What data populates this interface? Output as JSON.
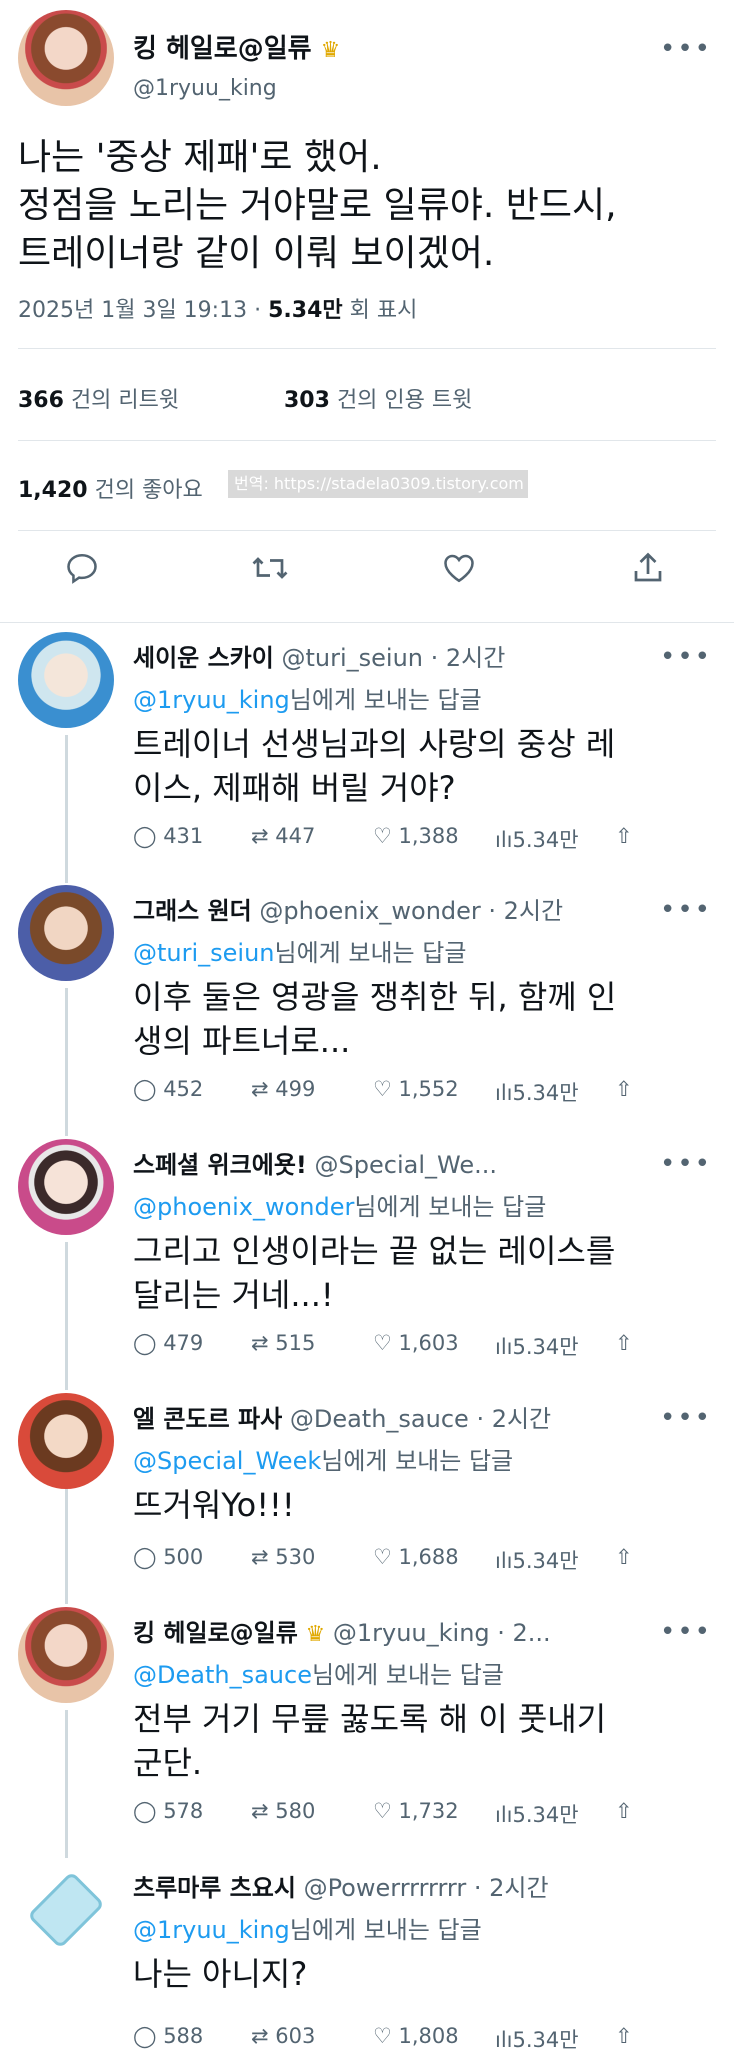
{
  "main": {
    "name": "킹 헤일로@일류",
    "handle": "@1ryuu_king",
    "text_lines": [
      "나는 '중상 제패'로 했어.",
      "정점을 노리는 거야말로 일류야. 반드시,",
      "트레이너랑 같이 이뤄 보이겠어."
    ],
    "timestamp": "2025년 1월 3일 19:13",
    "views": "5.34만",
    "views_label": "회 표시",
    "retweets": "366",
    "retweets_label": "건의 리트윗",
    "quotes": "303",
    "quotes_label": "건의 인용 트윗",
    "likes": "1,420",
    "likes_label": "건의 좋아요",
    "watermark": "번역: https://stadela0309.tistory.com"
  },
  "replies": [
    {
      "name": "세이운 스카이",
      "handle": "@turi_seiun",
      "time": "· 2시간",
      "to_handle": "@1ryuu_king",
      "to_suffix": "님에게 보내는 답글",
      "text_lines": [
        "트레이너 선생님과의 사랑의 중상 레",
        "이스, 제패해 버릴 거야?"
      ],
      "replies": "431",
      "retweets": "447",
      "likes": "1,388",
      "views": "5.34만"
    },
    {
      "name": "그래스 원더",
      "handle": "@phoenix_wonder",
      "time": "· 2시간",
      "to_handle": "@turi_seiun",
      "to_suffix": "님에게 보내는 답글",
      "text_lines": [
        "이후 둘은 영광을 쟁취한 뒤, 함께 인",
        "생의 파트너로..."
      ],
      "replies": "452",
      "retweets": "499",
      "likes": "1,552",
      "views": "5.34만"
    },
    {
      "name": "스페셜 위크에욧!",
      "handle": "@Special_We...",
      "time": "",
      "to_handle": "@phoenix_wonder",
      "to_suffix": "님에게 보내는 답글",
      "text_lines": [
        "그리고 인생이라는 끝 없는 레이스를",
        "달리는 거네...!"
      ],
      "replies": "479",
      "retweets": "515",
      "likes": "1,603",
      "views": "5.34만"
    },
    {
      "name": "엘 콘도르 파사",
      "handle": "@Death_sauce",
      "time": "· 2시간",
      "to_handle": "@Special_Week",
      "to_suffix": "님에게 보내는 답글",
      "text_lines": [
        "뜨거워Yo!!!"
      ],
      "replies": "500",
      "retweets": "530",
      "likes": "1,688",
      "views": "5.34만"
    },
    {
      "name": "킹 헤일로@일류",
      "handle": "@1ryuu_king · 2...",
      "time": "",
      "to_handle": "@Death_sauce",
      "to_suffix": "님에게 보내는 답글",
      "text_lines": [
        "전부 거기 무릎 꿇도록 해 이 풋내기",
        "군단."
      ],
      "replies": "578",
      "retweets": "580",
      "likes": "1,732",
      "views": "5.34만"
    },
    {
      "name": "츠루마루 츠요시",
      "handle": "@Powerrrrrrrr",
      "time": "· 2시간",
      "to_handle": "@1ryuu_king",
      "to_suffix": "님에게 보내는 답글",
      "text_lines": [
        "나는 아니지?"
      ],
      "replies": "588",
      "retweets": "603",
      "likes": "1,808",
      "views": "5.34만"
    }
  ],
  "colors": {
    "link": "#1d9bf0",
    "muted": "#536471",
    "text": "#0f1419",
    "divider": "#e1e6ea"
  }
}
